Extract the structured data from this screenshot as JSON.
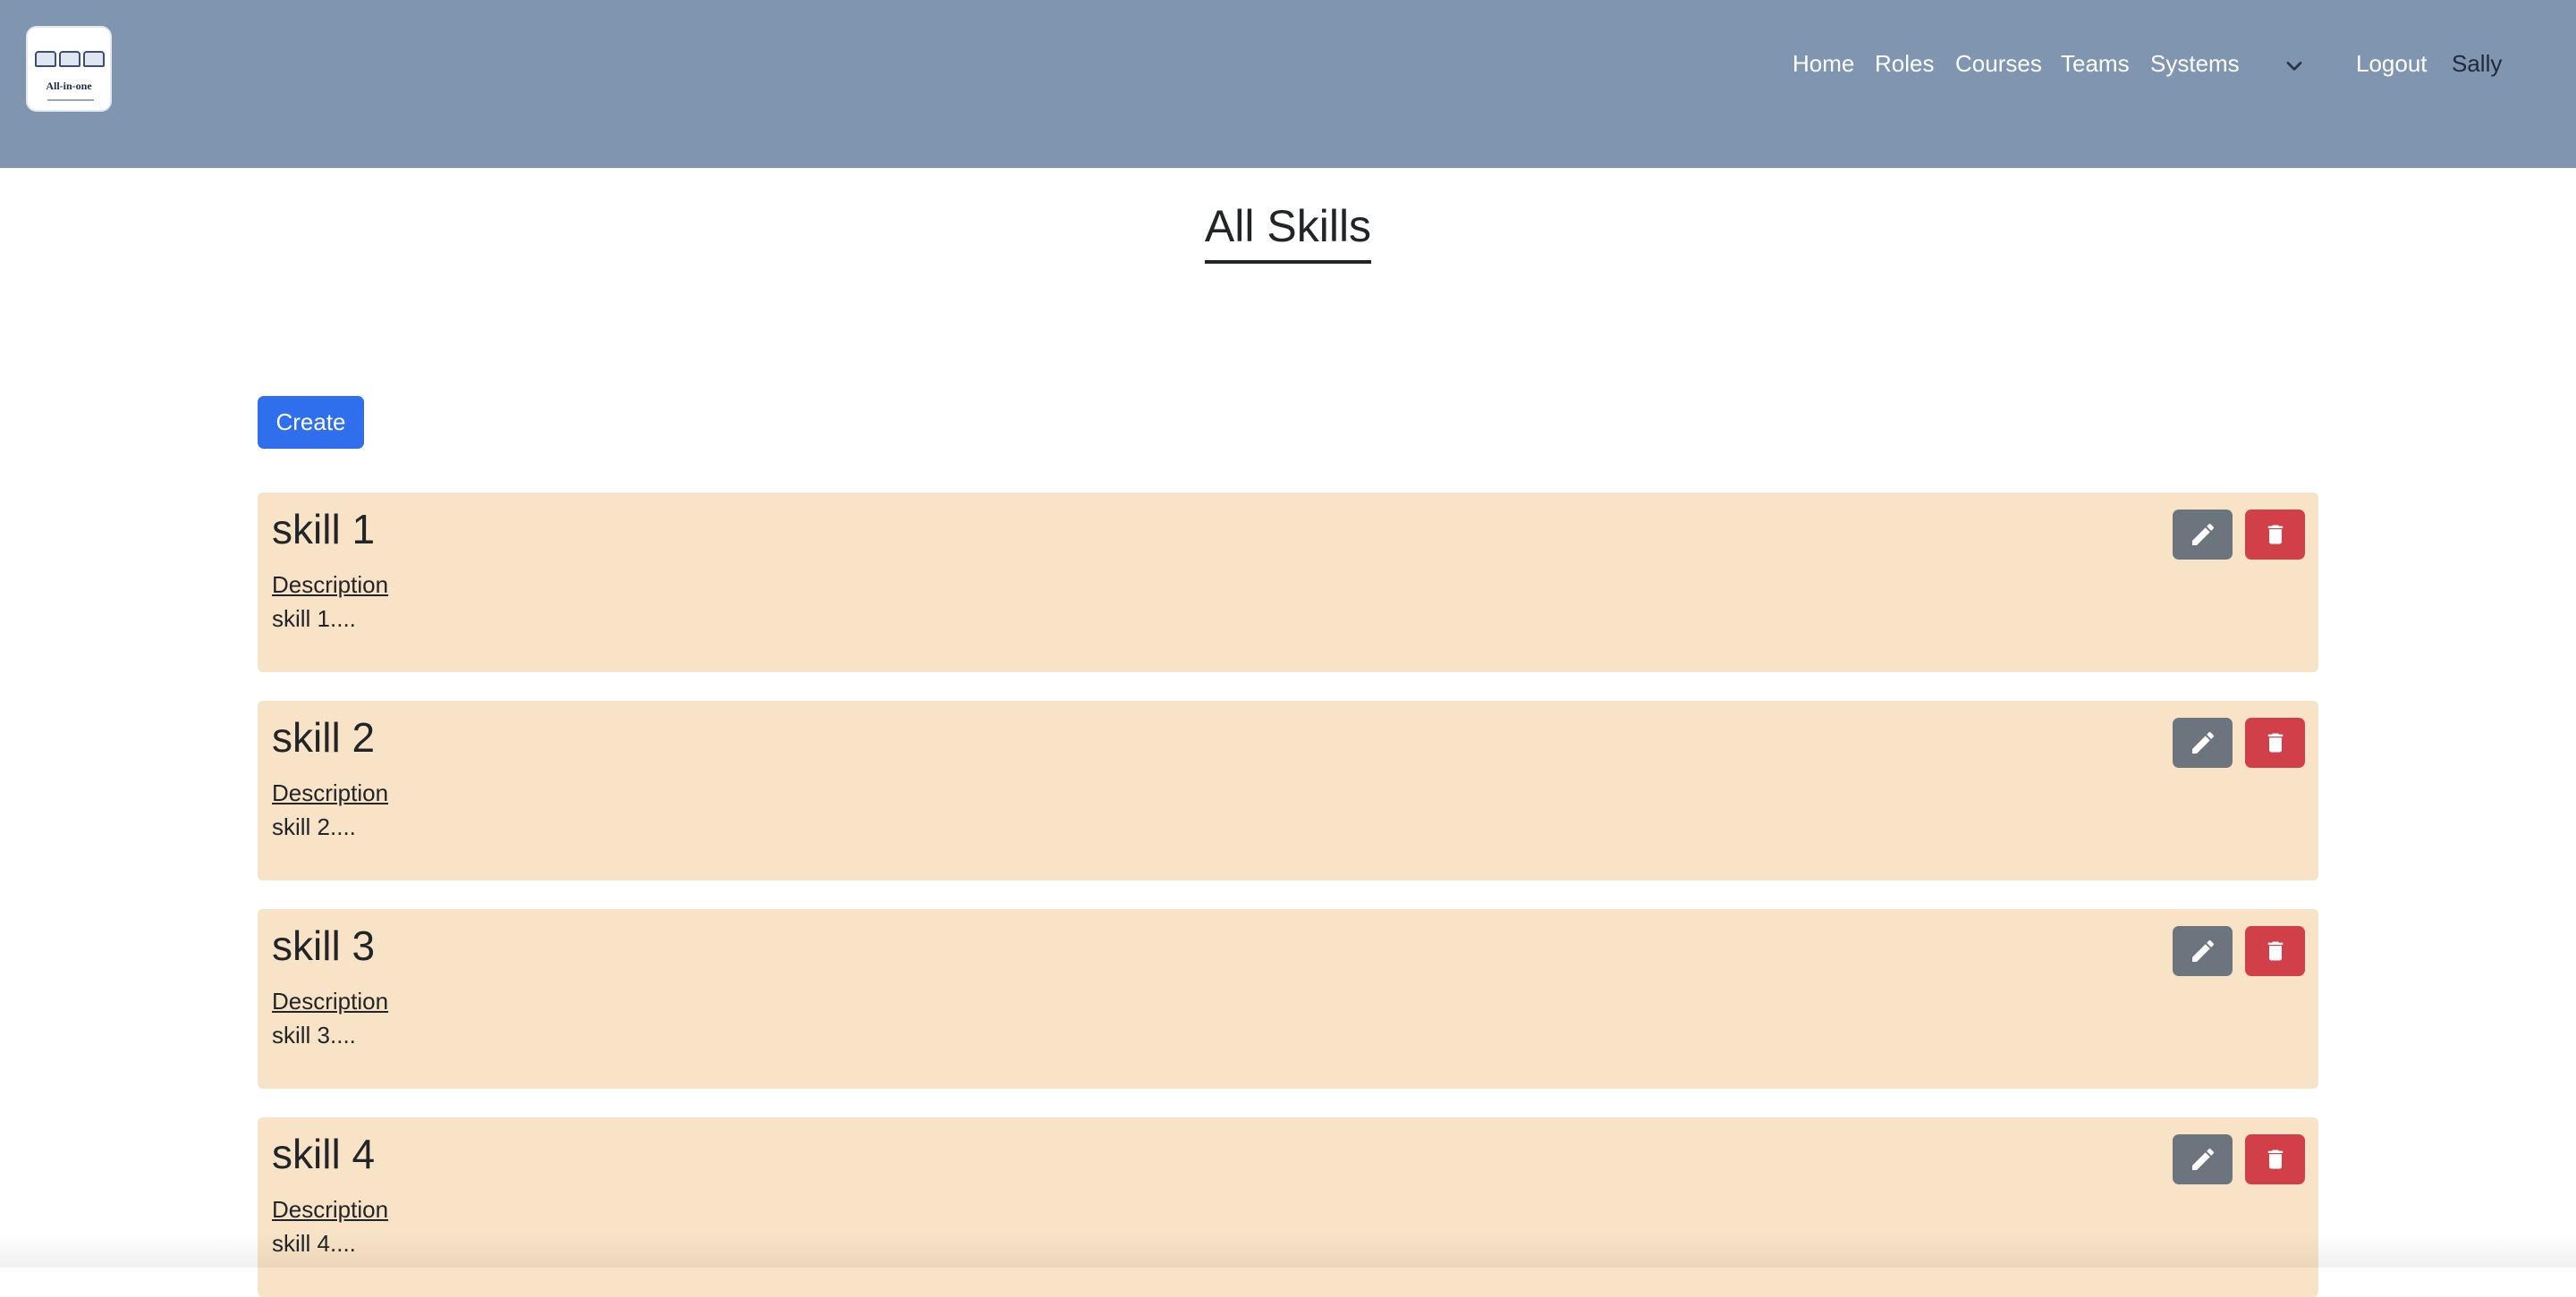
{
  "header": {
    "logo_text": "All-in-one",
    "nav": [
      {
        "label": "Home"
      },
      {
        "label": "Roles"
      },
      {
        "label": "Courses"
      },
      {
        "label": "Teams"
      },
      {
        "label": "Systems"
      }
    ],
    "logout_label": "Logout",
    "user_name": "Sally"
  },
  "page": {
    "title": "All Skills",
    "create_label": "Create"
  },
  "skills": [
    {
      "name": "skill 1",
      "description_label": "Description",
      "description": "skill 1...."
    },
    {
      "name": "skill 2",
      "description_label": "Description",
      "description": "skill 2...."
    },
    {
      "name": "skill 3",
      "description_label": "Description",
      "description": "skill 3...."
    },
    {
      "name": "skill 4",
      "description_label": "Description",
      "description": "skill 4...."
    }
  ],
  "colors": {
    "navbar": "#7f95b0",
    "card": "#f9e3c6",
    "primary": "#2f6fed",
    "edit": "#6c757d",
    "delete": "#d13f49"
  },
  "icons": {
    "edit": "pencil-icon",
    "delete": "trash-icon",
    "dropdown": "chevron-down-icon"
  }
}
